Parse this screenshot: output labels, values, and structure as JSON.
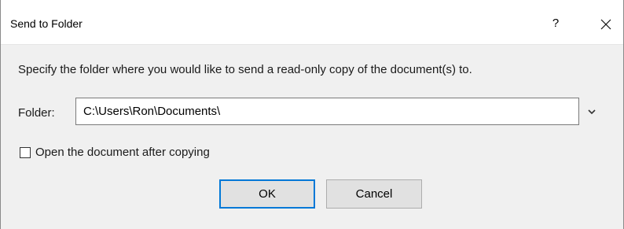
{
  "window": {
    "title": "Send to Folder",
    "help_label": "?",
    "close_icon": "close-icon"
  },
  "instruction": "Specify the folder where you would like to send a read-only copy of the document(s) to.",
  "folder": {
    "label": "Folder:",
    "value": "C:\\Users\\Ron\\Documents\\",
    "dropdown_icon": "chevron-down-icon"
  },
  "open_after_copy": {
    "label": "Open the document after copying",
    "checked": false
  },
  "buttons": {
    "ok_label": "OK",
    "cancel_label": "Cancel"
  },
  "colors": {
    "accent": "#0078d7",
    "dialog_bg": "#f0f0f0",
    "titlebar_bg": "#ffffff"
  }
}
